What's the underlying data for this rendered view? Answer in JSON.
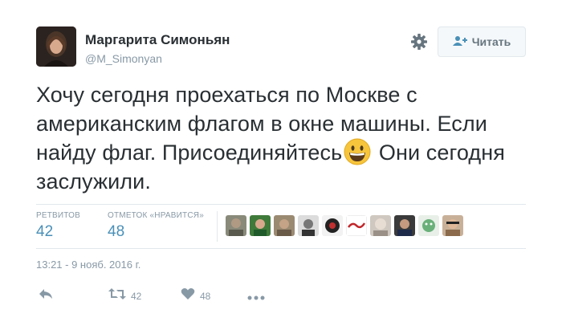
{
  "user": {
    "name": "Маргарита Симоньян",
    "handle": "@M_Simonyan"
  },
  "follow_button": {
    "label": "Читать"
  },
  "tweet": {
    "text_before_emoji": "Хочу сегодня проехаться по Москве с американским флагом в окне машины. Если найду флаг. Присоединяйтесь",
    "emoji": "grinning-face-emoji",
    "text_after_emoji": " Они сегодня заслужили."
  },
  "stats": {
    "retweets_label": "РЕТВИТОВ",
    "retweets_value": "42",
    "likes_label": "ОТМЕТОК «НРАВИТСЯ»",
    "likes_value": "48"
  },
  "likers": [
    "avatar-1",
    "avatar-2",
    "avatar-3",
    "avatar-4",
    "avatar-5",
    "avatar-6",
    "avatar-7",
    "avatar-8",
    "avatar-9",
    "avatar-10"
  ],
  "timestamp": "13:21 - 9 нояб. 2016 г.",
  "actions": {
    "reply_icon": "reply-icon",
    "retweet_icon": "retweet-icon",
    "retweet_count": "42",
    "like_icon": "heart-icon",
    "like_count": "48",
    "more_icon": "more-icon"
  },
  "colors": {
    "link": "#4a90b8",
    "muted": "#8899a6",
    "text": "#292f33",
    "divider": "#e1e8ed"
  }
}
